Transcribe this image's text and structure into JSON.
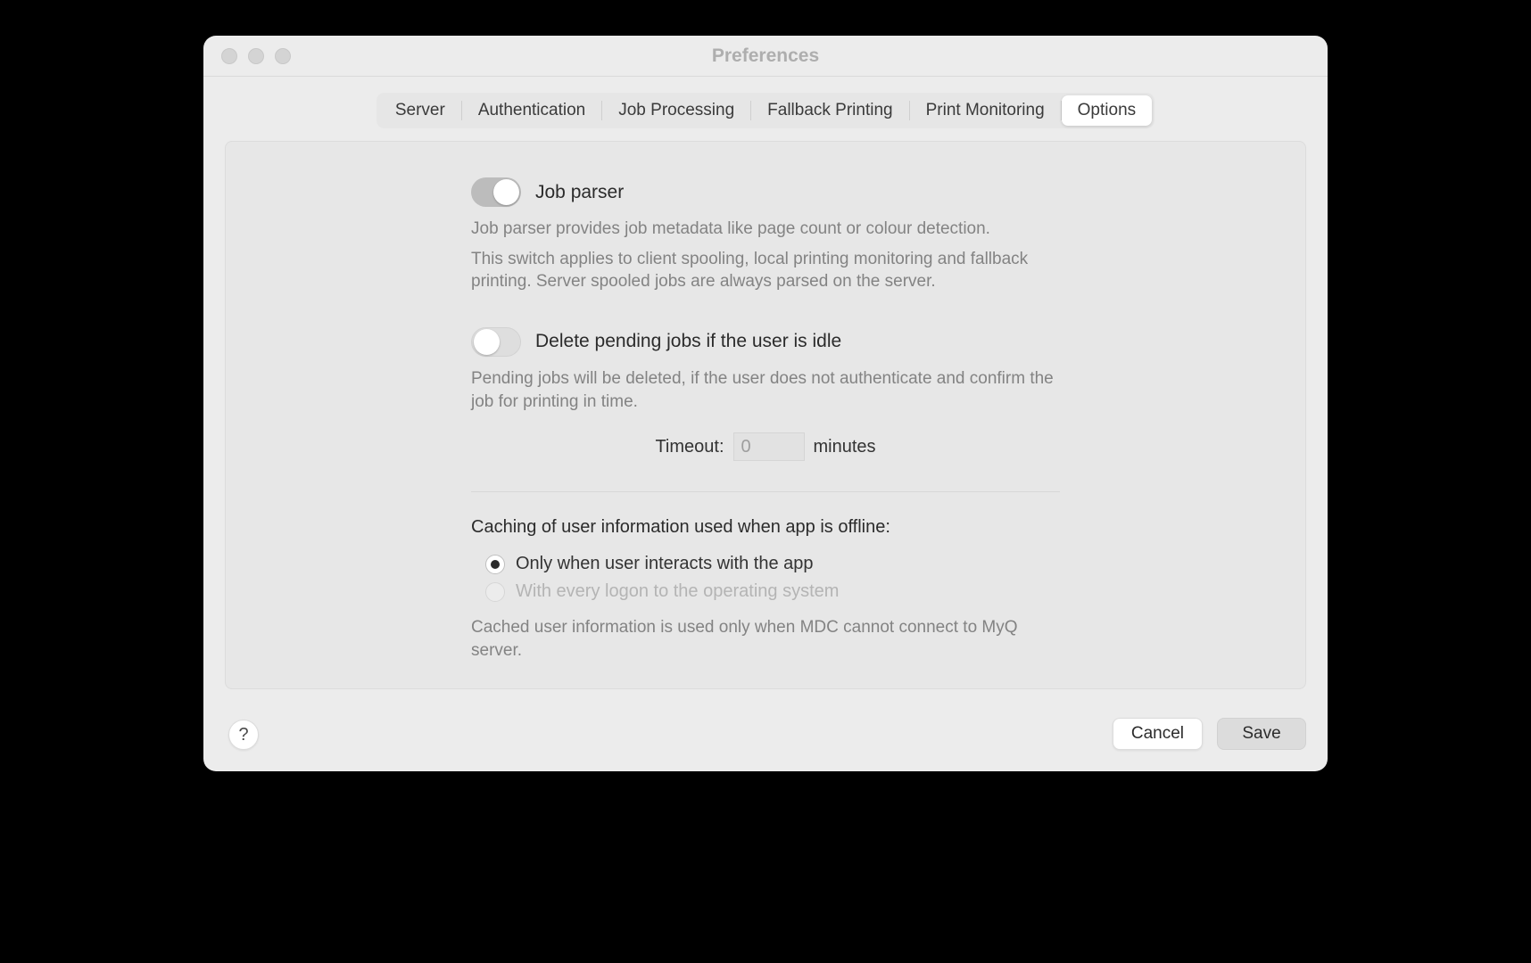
{
  "window": {
    "title": "Preferences"
  },
  "tabs": {
    "items": [
      "Server",
      "Authentication",
      "Job Processing",
      "Fallback Printing",
      "Print Monitoring",
      "Options"
    ],
    "activeIndex": 5
  },
  "options": {
    "jobParser": {
      "label": "Job parser",
      "enabled": true,
      "desc1": "Job parser provides job metadata like page count or colour detection.",
      "desc2": "This switch applies to client spooling, local printing monitoring and fallback printing. Server spooled jobs are always parsed on the server."
    },
    "deletePending": {
      "label": "Delete pending jobs if the user is idle",
      "enabled": false,
      "desc": "Pending jobs will be deleted, if the user does not authenticate and confirm the job for printing in time.",
      "timeoutLabel": "Timeout:",
      "timeoutValue": "0",
      "timeoutUnit": "minutes"
    },
    "caching": {
      "heading": "Caching of user information used when app is offline:",
      "option1": "Only when user interacts with the app",
      "option2": "With every logon to the operating system",
      "selected": 0,
      "option2Disabled": true,
      "desc": "Cached user information is used only when MDC cannot connect to MyQ server."
    }
  },
  "footer": {
    "help": "?",
    "cancel": "Cancel",
    "save": "Save"
  }
}
